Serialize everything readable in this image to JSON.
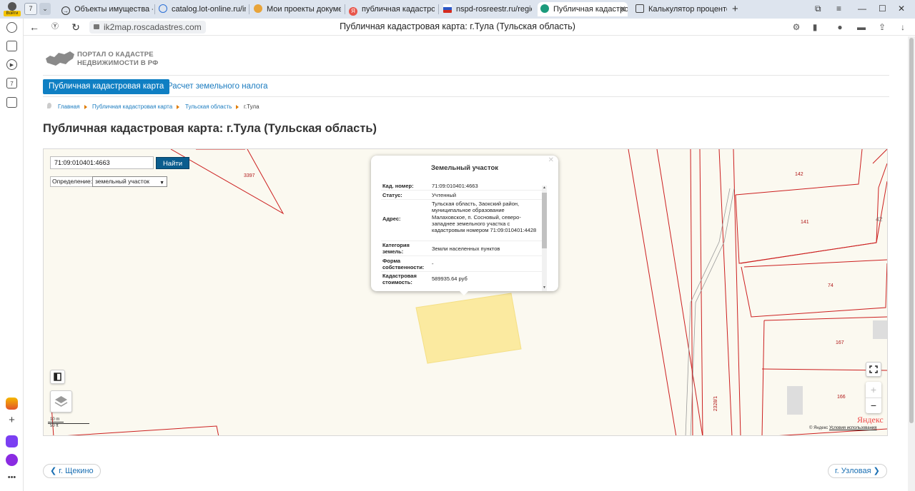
{
  "browser": {
    "profile_badge": "Войти",
    "tab_count": "7",
    "tabs": [
      {
        "title": "Объекты имущества - ф"
      },
      {
        "title": "catalog.lot-online.ru/inde"
      },
      {
        "title": "Мои проекты документ"
      },
      {
        "title": "публичная кадастровая"
      },
      {
        "title": "nspd-rosreestr.ru/region/"
      },
      {
        "title": "Публичная кадастров",
        "active": true
      },
      {
        "title": "Калькулятор процентов"
      }
    ],
    "url": "ik2map.roscadastres.com",
    "page_title": "Публичная кадастровая карта: г.Тула (Тульская область)",
    "sidebar_badge": "7"
  },
  "site": {
    "logo_line1": "ПОРТАЛ О КАДАСТРЕ",
    "logo_line2": "НЕДВИЖИМОСТИ В РФ",
    "nav": [
      "Публичная кадастровая карта",
      "Расчет земельного налога"
    ],
    "breadcrumbs": [
      "Главная",
      "Публичная кадастровая карта",
      "Тульская область",
      "г.Тула"
    ],
    "heading": "Публичная кадастровая карта: г.Тула (Тульская область)"
  },
  "map": {
    "search_value": "71:09:010401:4663",
    "search_button": "Найти",
    "definition_label": "Определение:",
    "definition_value": "земельный участок",
    "popup": {
      "title": "Земельный участок",
      "rows": [
        {
          "key": "Кад. номер:",
          "value": "71:09:010401:4663"
        },
        {
          "key": "Статус:",
          "value": "Учтенный"
        },
        {
          "key": "Адрес:",
          "value": "Тульская область, Заокский район, муниципальное образование Малаховское, п. Сосновый, северо-западнее земельного участка с кадастровым номером 71:09:010401:4428"
        },
        {
          "key": "Категория земель:",
          "value": "Земли населенных пунктов"
        },
        {
          "key": "Форма собственности:",
          "value": "-"
        },
        {
          "key": "Кадастровая стоимость:",
          "value": "589935.64 руб"
        }
      ]
    },
    "plot_labels": [
      "3397",
      "142",
      "141",
      "74",
      "167",
      "166",
      "42",
      "2328/1"
    ],
    "scale_top": "10 m",
    "scale_bottom": "50 ft",
    "provider": "Яндекс",
    "copyright": "© Яндекс",
    "terms": "Условия использования",
    "colors": {
      "boundary": "#cc1f1f",
      "selected_plot": "#fbeaa0"
    }
  },
  "pager": {
    "prev": "г. Щекино",
    "next": "г. Узловая"
  }
}
